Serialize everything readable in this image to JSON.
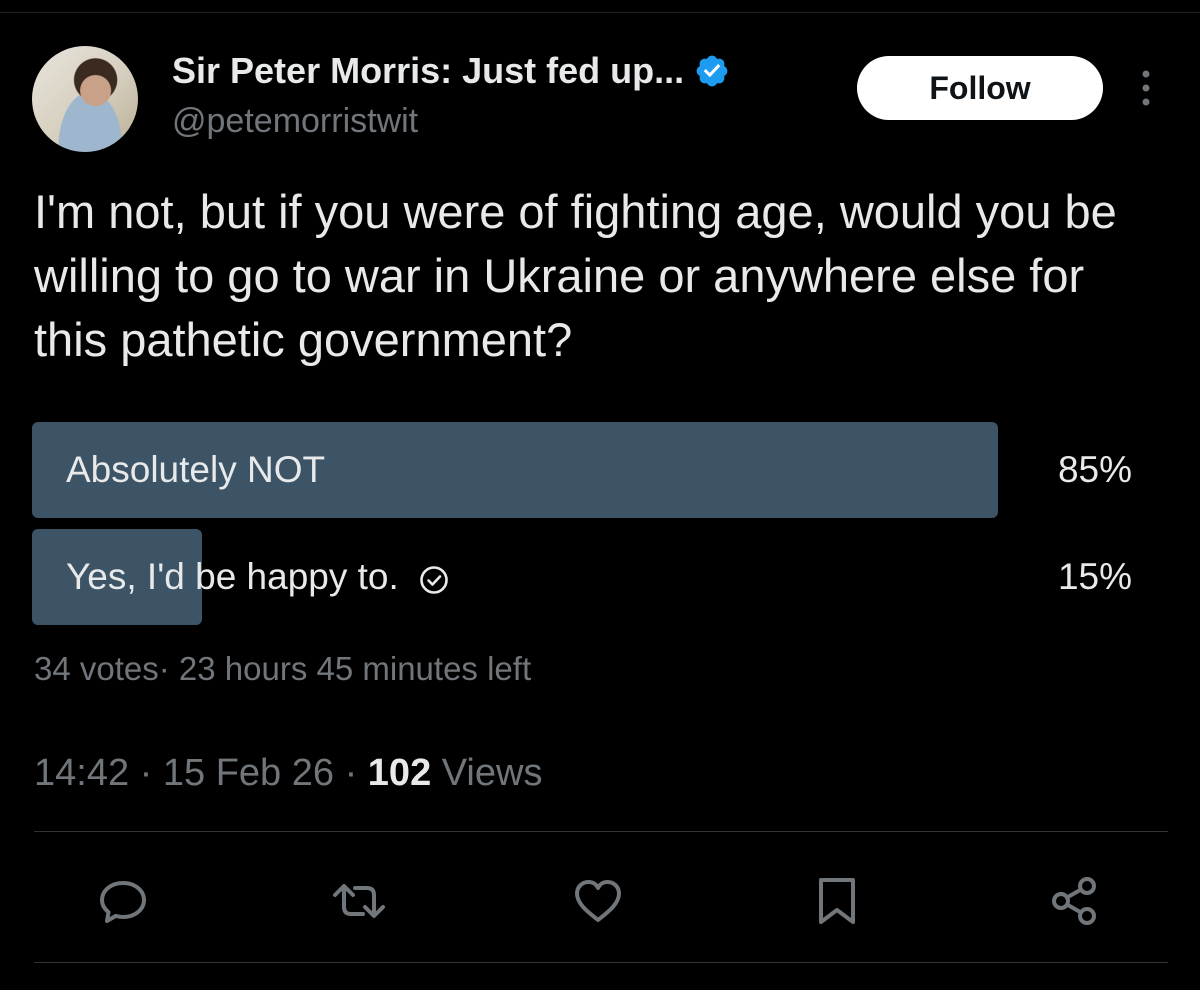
{
  "author": {
    "display_name": "Sir Peter Morris: Just fed up...",
    "handle": "@petemorristwit",
    "verified_color": "#1d9bf0"
  },
  "follow_label": "Follow",
  "tweet": {
    "text": "I'm not, but if you were of fighting age, would you be willing to go to war in Ukraine or anywhere else for this pathetic government?"
  },
  "poll": {
    "options": [
      {
        "label": "Absolutely NOT",
        "percent_text": "85%",
        "share": 0.85,
        "selected": false
      },
      {
        "label": "Yes, I'd be happy to.",
        "percent_text": "15%",
        "share": 0.15,
        "selected": true
      }
    ],
    "votes_text": "34 votes",
    "separator": "·",
    "time_left": "23 hours 45 minutes left",
    "bar_color": "#3d5466"
  },
  "meta": {
    "time": "14:42",
    "date": "15 Feb 26",
    "views_count": "102",
    "views_label": "Views",
    "dot": "·"
  },
  "actions": [
    "reply-icon",
    "retweet-icon",
    "like-icon",
    "bookmark-icon",
    "share-icon"
  ]
}
